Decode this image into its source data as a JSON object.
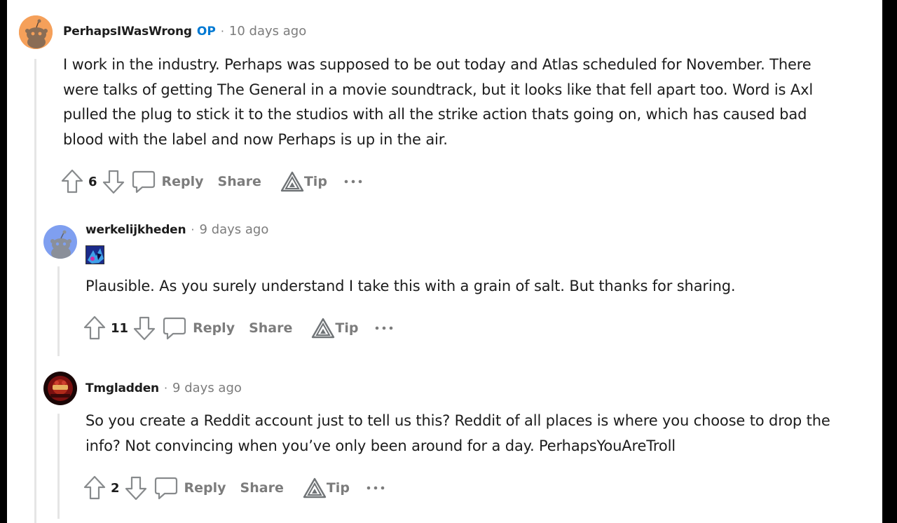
{
  "comments": [
    {
      "username": "PerhapsIWasWrong",
      "op_badge": "OP",
      "separator": "·",
      "time": "10 days ago",
      "body": "I work in the industry. Perhaps was supposed to be out today and Atlas scheduled for November. There were talks of getting The General in a movie soundtrack, but it looks like that fell apart too. Word is Axl pulled the plug to stick it to the studios with all the strike action thats going on, which has caused bad blood with the label and now Perhaps is up in the air.",
      "score": "6",
      "reply_label": "Reply",
      "share_label": "Share",
      "tip_label": "Tip",
      "avatar_color": "#f5a05a"
    },
    {
      "username": "werkelijkheden",
      "separator": "·",
      "time": "9 days ago",
      "body": "Plausible. As you surely understand I take this with a grain of salt. But thanks for sharing.",
      "score": "11",
      "reply_label": "Reply",
      "share_label": "Share",
      "tip_label": "Tip",
      "avatar_color": "#7f9ff0"
    },
    {
      "username": "Tmgladden",
      "separator": "·",
      "time": "9 days ago",
      "body": "So you create a Reddit account just to tell us this? Reddit of all places is where you choose to drop the info? Not convincing when you’ve only been around for a day. PerhapsYouAreTroll",
      "score": "2",
      "reply_label": "Reply",
      "share_label": "Share",
      "tip_label": "Tip",
      "avatar_color": "#7a1010"
    }
  ],
  "colors": {
    "op_blue": "#0079d3",
    "meta_gray": "#7c7c7c",
    "thread_line": "#e5e5e5"
  },
  "icons": [
    "upvote-icon",
    "downvote-icon",
    "comment-icon",
    "tip-icon",
    "more-icon"
  ]
}
